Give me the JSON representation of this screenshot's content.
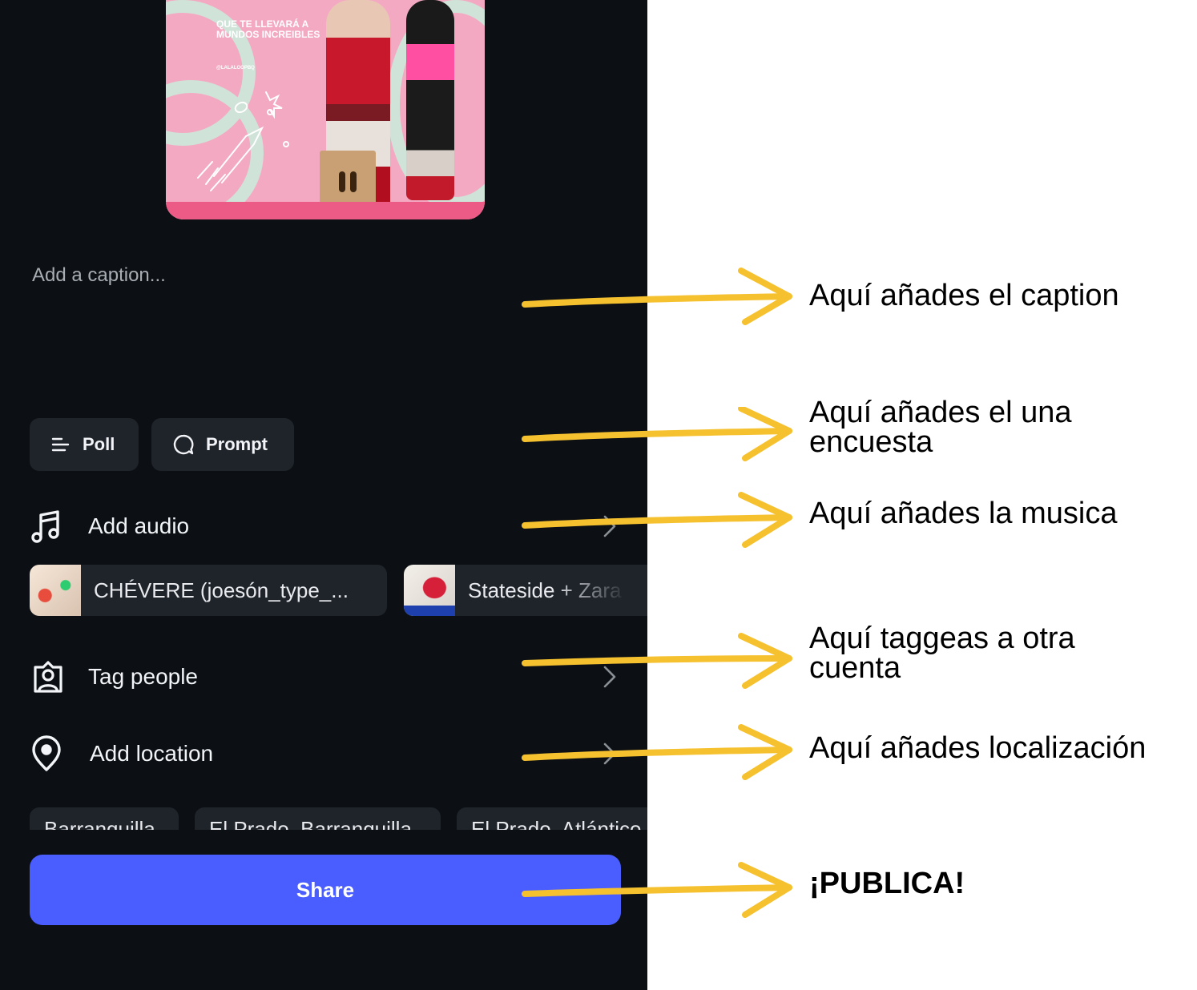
{
  "preview": {
    "headline": "QUE TE LLEVARÁ A MUNDOS INCREIBLES",
    "handle": "@LALALOOPBQ"
  },
  "caption": {
    "placeholder": "Add a caption..."
  },
  "pills": {
    "poll": "Poll",
    "prompt": "Prompt"
  },
  "rows": {
    "audio": "Add audio",
    "tag": "Tag people",
    "location": "Add location"
  },
  "audio_suggestions": [
    {
      "title": "CHÉVERE (joesón_type_..."
    },
    {
      "title": "Stateside + Zara"
    }
  ],
  "location_suggestions": [
    "Barranquilla",
    "El Prado, Barranquilla",
    "El Prado, Atlántico"
  ],
  "share": {
    "label": "Share"
  },
  "annotations": {
    "caption": "Aquí añades el caption",
    "poll_line1": "Aquí añades el una",
    "poll_line2": "encuesta",
    "audio": "Aquí añades la musica",
    "tag_line1": "Aquí taggeas a otra",
    "tag_line2": "cuenta",
    "location": "Aquí añades localización",
    "publish": "¡PUBLICA!"
  },
  "colors": {
    "background": "#0c1014",
    "chip": "#1f242b",
    "share_button": "#4a5dff",
    "arrow": "#f6c12f"
  },
  "icons": [
    "poll-icon",
    "prompt-icon",
    "music-note-icon",
    "tag-person-icon",
    "location-pin-icon",
    "chevron-right-icon"
  ]
}
